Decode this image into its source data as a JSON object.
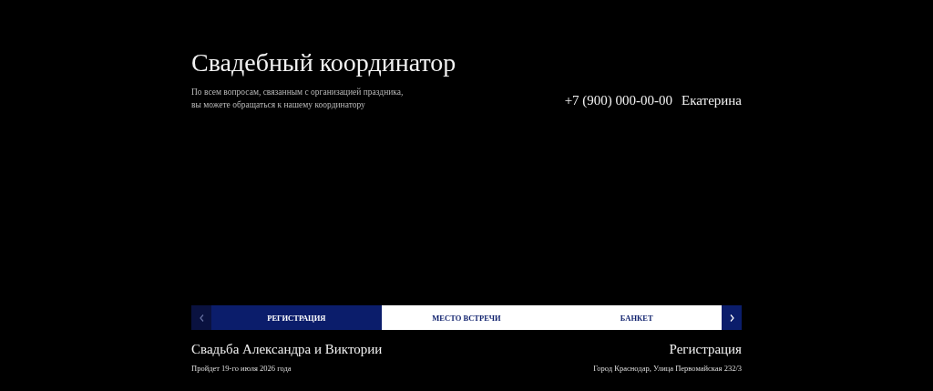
{
  "header": {
    "title": "Свадебный координатор",
    "subtitle_lines": [
      "По всем вопросам, связанным с организацией праздника,",
      "вы можете обращаться к нашему координатору"
    ],
    "phone": "+7 (900) 000-00-00",
    "contact_name": "Екатерина"
  },
  "nav": {
    "prev_disabled": true,
    "next_disabled": false
  },
  "tabs": [
    {
      "label": "РЕГИСТРАЦИЯ",
      "selected": true
    },
    {
      "label": "МЕСТО ВСТРЕЧИ",
      "selected": false
    },
    {
      "label": "БАНКЕТ",
      "selected": false
    }
  ],
  "event": {
    "title": "Свадьба Александра и Виктории",
    "date": "Пройдет 19-го июля 2026 года"
  },
  "location": {
    "title": "Регистрация",
    "address": "Город Краснодар, Улица Первомайская 232/3"
  }
}
